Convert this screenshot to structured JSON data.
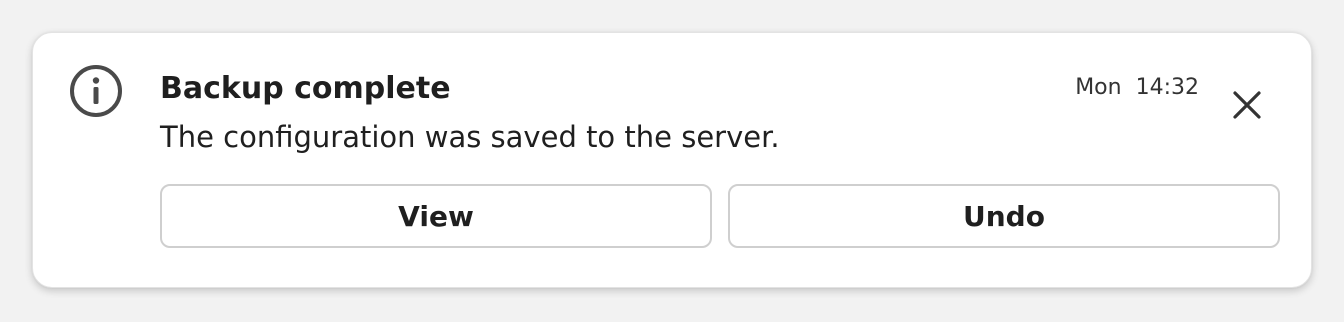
{
  "notification": {
    "icon": "info-icon",
    "title": "Backup complete",
    "message": "The configuration was saved to the server.",
    "day": "Mon",
    "time": "14:32",
    "close_icon": "close-icon",
    "actions": {
      "primary_label": "View",
      "secondary_label": "Undo"
    }
  },
  "colors": {
    "background": "#f2f2f2",
    "surface": "#ffffff",
    "text": "#1f1f1f",
    "border": "#cfcfcf",
    "icon": "#4a4a4a"
  }
}
